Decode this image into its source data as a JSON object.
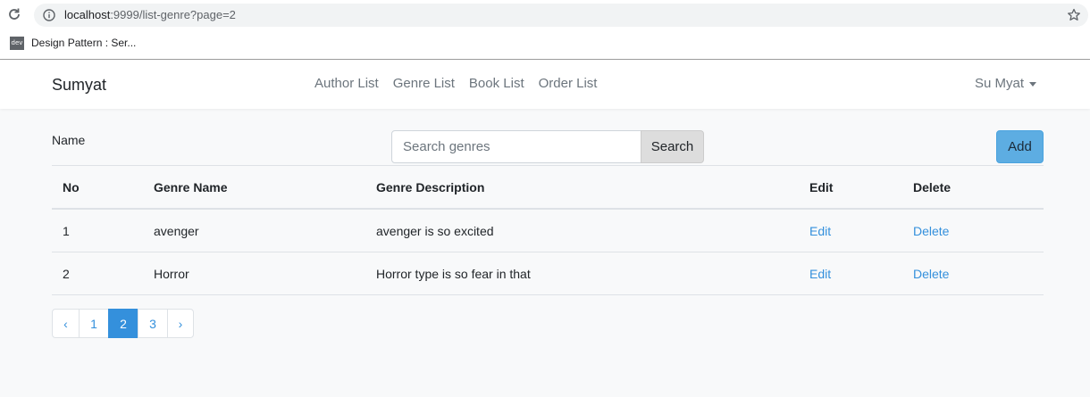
{
  "browser": {
    "url_host": "localhost",
    "url_path": ":9999/list-genre?page=2",
    "bookmark_icon_text": "dev",
    "bookmark_label": "Design Pattern : Ser..."
  },
  "navbar": {
    "brand": "Sumyat",
    "links": [
      "Author List",
      "Genre List",
      "Book List",
      "Order List"
    ],
    "user": "Su Myat"
  },
  "toolbar": {
    "name_label": "Name",
    "search_placeholder": "Search genres",
    "search_button": "Search",
    "add_button": "Add"
  },
  "table": {
    "headers": [
      "No",
      "Genre Name",
      "Genre Description",
      "Edit",
      "Delete"
    ],
    "rows": [
      {
        "no": "1",
        "name": "avenger",
        "description": "avenger is so excited",
        "edit": "Edit",
        "delete": "Delete"
      },
      {
        "no": "2",
        "name": "Horror",
        "description": "Horror type is so fear in that",
        "edit": "Edit",
        "delete": "Delete"
      }
    ]
  },
  "pagination": {
    "prev": "‹",
    "pages": [
      "1",
      "2",
      "3"
    ],
    "next": "›",
    "current_page": "2"
  },
  "colors": {
    "accent": "#3490dc",
    "add_button": "#5dade2",
    "background": "#f8f9fa"
  }
}
